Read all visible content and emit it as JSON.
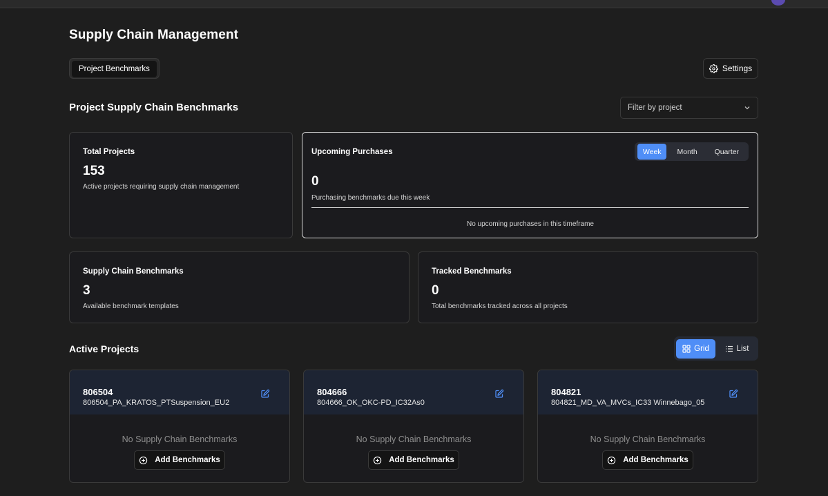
{
  "app": {
    "title": "Supply Chain Management"
  },
  "tabs": [
    {
      "label": "Project Benchmarks",
      "active": true
    }
  ],
  "header": {
    "settings_label": "Settings"
  },
  "benchmarks_section": {
    "title": "Project Supply Chain Benchmarks",
    "filter_placeholder": "Filter by project"
  },
  "stats": {
    "total_projects": {
      "label": "Total Projects",
      "value": "153",
      "description": "Active projects requiring supply chain management"
    },
    "upcoming_purchases": {
      "label": "Upcoming Purchases",
      "value": "0",
      "description": "Purchasing benchmarks due this week",
      "ranges": [
        "Week",
        "Month",
        "Quarter"
      ],
      "selected_range": "Week",
      "empty_message": "No upcoming purchases in this timeframe"
    },
    "supply_chain_benchmarks": {
      "label": "Supply Chain Benchmarks",
      "value": "3",
      "description": "Available benchmark templates"
    },
    "tracked_benchmarks": {
      "label": "Tracked Benchmarks",
      "value": "0",
      "description": "Total benchmarks tracked across all projects"
    }
  },
  "active_projects": {
    "title": "Active Projects",
    "view_modes": [
      "Grid",
      "List"
    ],
    "selected_view": "Grid",
    "projects": [
      {
        "id": "806504",
        "name": "806504_PA_KRATOS_PTSuspension_EU2",
        "empty_text": "No Supply Chain Benchmarks",
        "add_label": "Add Benchmarks"
      },
      {
        "id": "804666",
        "name": "804666_OK_OKC-PD_IC32As0",
        "empty_text": "No Supply Chain Benchmarks",
        "add_label": "Add Benchmarks"
      },
      {
        "id": "804821",
        "name": "804821_MD_VA_MVCs_IC33 Winnebago_05",
        "empty_text": "No Supply Chain Benchmarks",
        "add_label": "Add Benchmarks"
      }
    ]
  },
  "colors": {
    "accent": "#4f8ef7",
    "background": "#1e1e1e",
    "card": "#1b1b1e",
    "project_header": "#1d2433"
  }
}
